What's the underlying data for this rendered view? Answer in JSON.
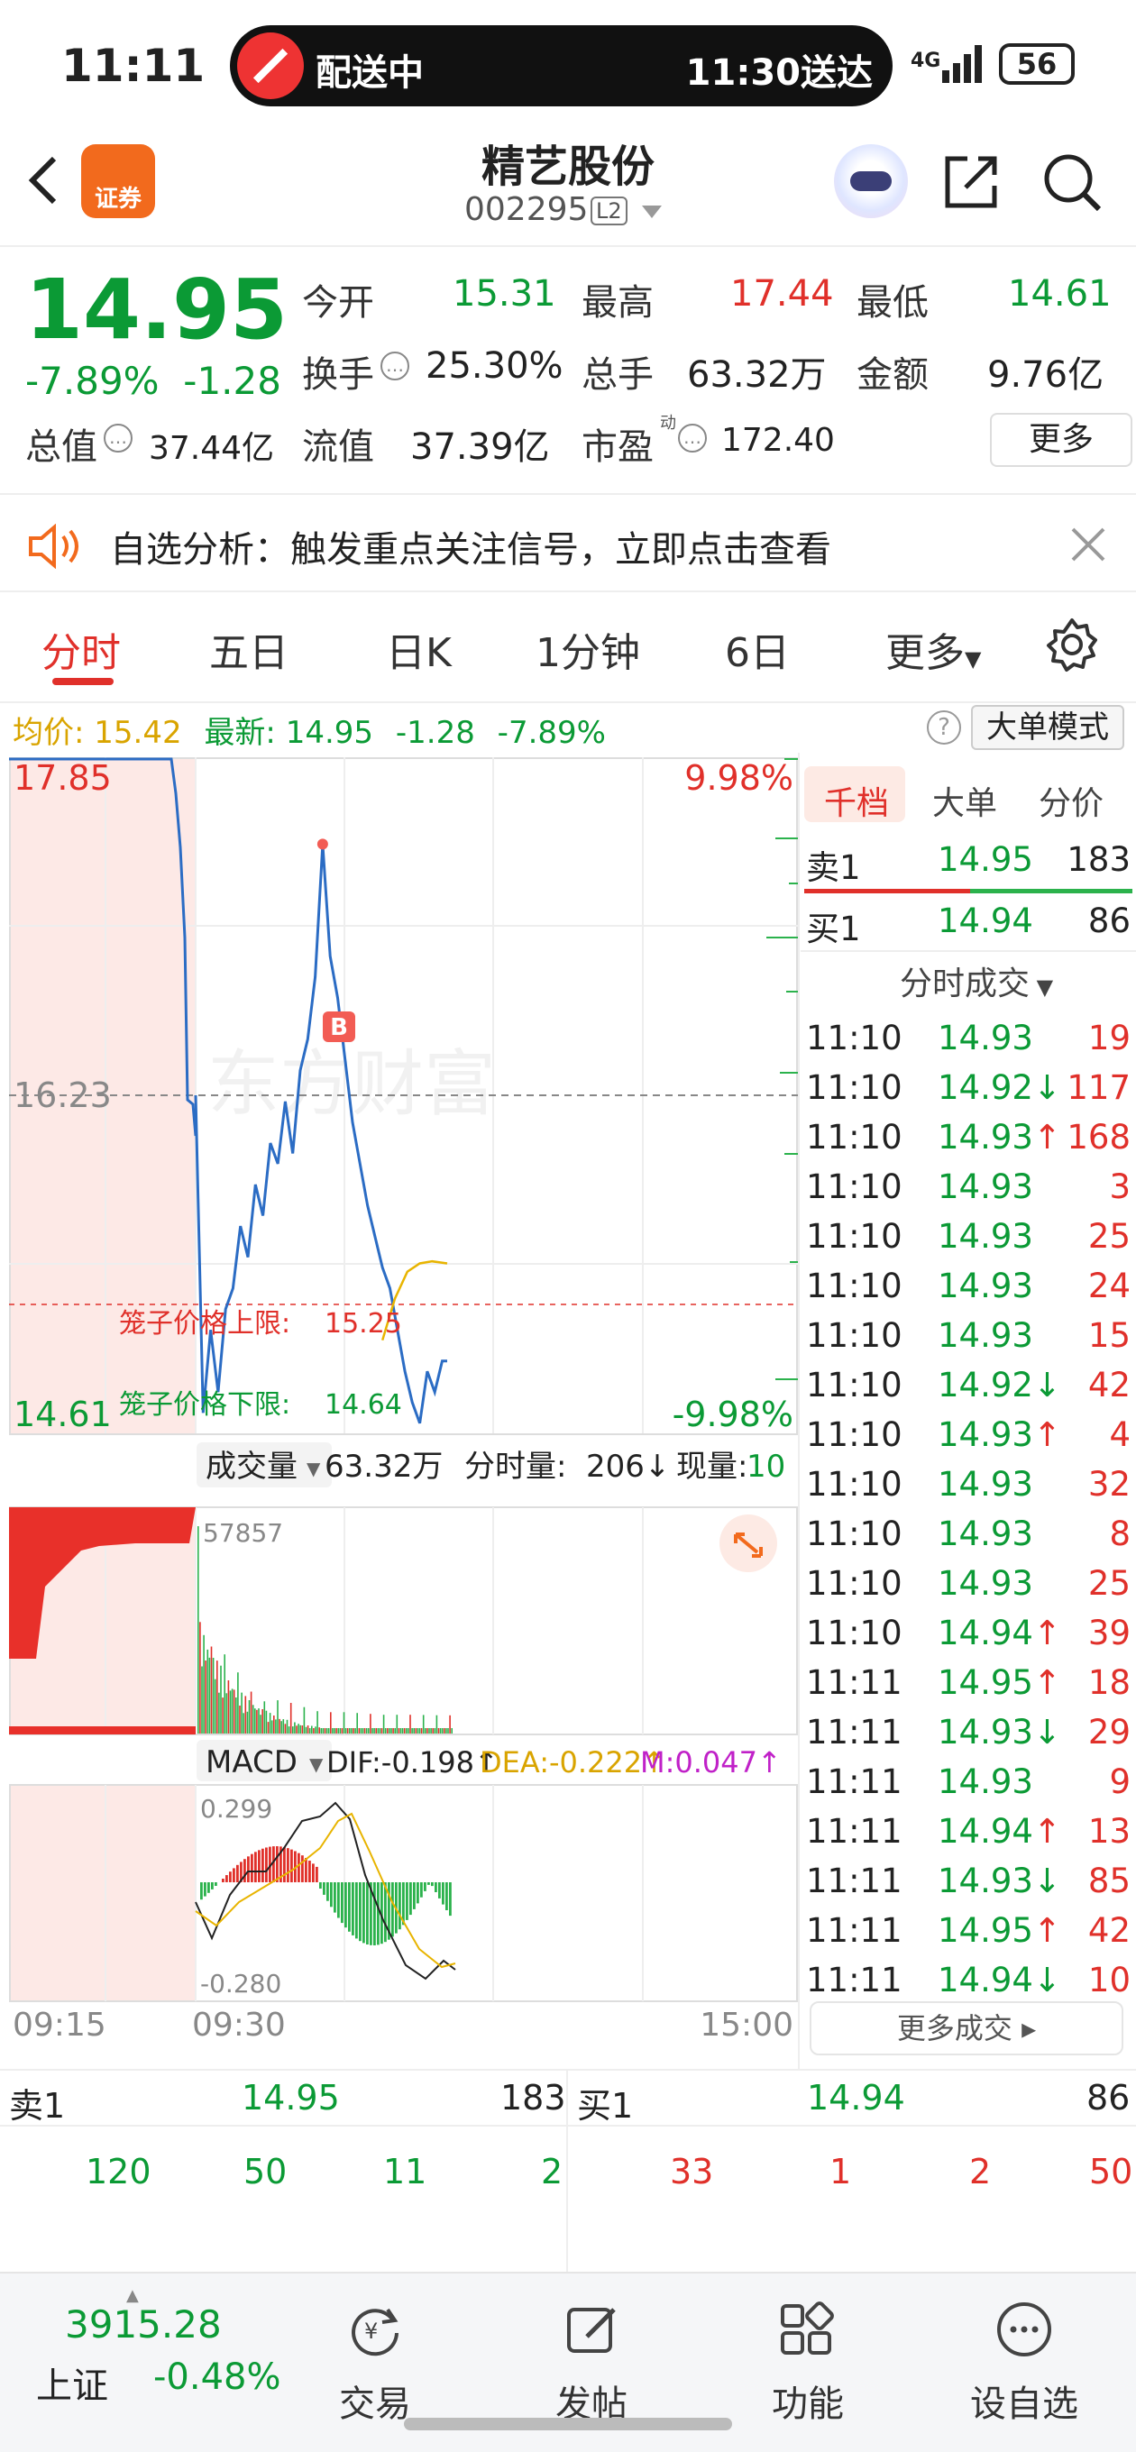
{
  "status_bar": {
    "time": "11:11",
    "pill_left": "配送中",
    "pill_right": "11:30送达",
    "signal": "4G",
    "battery": "56"
  },
  "header": {
    "logo_text": "证券",
    "stock_name": "精艺股份",
    "stock_code": "002295",
    "level_badge": "L2"
  },
  "quote": {
    "price": "14.95",
    "change_pct": "-7.89%",
    "change": "-1.28",
    "open_label": "今开",
    "open": "15.31",
    "high_label": "最高",
    "high": "17.44",
    "low_label": "最低",
    "low": "14.61",
    "turnover_label": "换手",
    "turnover": "25.30%",
    "volume_label": "总手",
    "volume": "63.32万",
    "amount_label": "金额",
    "amount": "9.76亿",
    "mktcap_label": "总值",
    "mktcap": "37.44亿",
    "float_label": "流值",
    "float": "37.39亿",
    "pe_label": "市盈",
    "pe_sup": "动",
    "pe": "172.40",
    "more": "更多"
  },
  "notice": {
    "text": "自选分析：触发重点关注信号，立即点击查看"
  },
  "tabs": [
    "分时",
    "五日",
    "日K",
    "1分钟",
    "6日",
    "更多"
  ],
  "info": {
    "avg_label": "均价:",
    "avg": "15.42",
    "latest_label": "最新:",
    "latest": "14.95",
    "chg": "-1.28",
    "pct": "-7.89%",
    "big_order": "大单模式"
  },
  "chart_data": {
    "type": "line",
    "y_axis_left": [
      "17.85",
      "16.23",
      "14.61"
    ],
    "y_axis_right": [
      "9.98%",
      "-9.98%"
    ],
    "cage_upper_label": "笼子价格上限:",
    "cage_upper": "15.25",
    "cage_lower_label": "笼子价格下限:",
    "cage_lower": "14.64",
    "marker": "B",
    "watermark": "东方财富",
    "time_labels": [
      "09:15",
      "09:30",
      "15:00"
    ],
    "price_series": {
      "name": "price",
      "x": [
        "09:30",
        "09:33",
        "09:36",
        "09:39",
        "09:42",
        "09:45",
        "09:48",
        "09:51",
        "09:54",
        "09:57",
        "10:00",
        "10:03",
        "10:06",
        "10:09",
        "10:12",
        "10:15",
        "10:18",
        "10:21",
        "10:24",
        "10:27",
        "10:30",
        "10:33",
        "10:36",
        "10:39",
        "10:42",
        "10:45",
        "10:48",
        "10:51",
        "10:54",
        "10:57",
        "11:00",
        "11:03",
        "11:06",
        "11:09",
        "11:11"
      ],
      "values": [
        16.23,
        14.7,
        15.1,
        14.8,
        15.2,
        15.3,
        15.6,
        15.45,
        15.8,
        15.65,
        16.0,
        15.9,
        16.2,
        15.95,
        16.35,
        16.5,
        16.8,
        17.44,
        16.9,
        16.7,
        16.4,
        16.1,
        15.9,
        15.7,
        15.55,
        15.4,
        15.3,
        15.1,
        14.9,
        14.75,
        14.65,
        14.9,
        14.8,
        14.95,
        14.95
      ]
    },
    "avg_series": {
      "name": "avg",
      "x": [
        "10:45",
        "10:50",
        "10:55",
        "11:00",
        "11:05",
        "11:11"
      ],
      "values": [
        15.05,
        15.25,
        15.38,
        15.42,
        15.43,
        15.42
      ]
    },
    "volume": {
      "label": "成交量",
      "total": "63.32万",
      "tick_label": "分时量:",
      "tick": "206↓",
      "now_label": "现量:",
      "now": "10",
      "max": "57857"
    },
    "macd": {
      "label": "MACD",
      "dif": "DIF:-0.198↑",
      "dea": "DEA:-0.222↑",
      "m": "M:0.047↑",
      "top": "0.299",
      "bottom": "-0.280"
    }
  },
  "right_panel": {
    "tabs": [
      "千档",
      "大单",
      "分价"
    ],
    "sell1": {
      "label": "卖1",
      "price": "14.95",
      "vol": "183"
    },
    "buy1": {
      "label": "买1",
      "price": "14.94",
      "vol": "86"
    },
    "trades_title": "分时成交",
    "trades": [
      {
        "t": "11:10",
        "p": "14.93",
        "d": "",
        "v": "19"
      },
      {
        "t": "11:10",
        "p": "14.92",
        "d": "↓",
        "v": "117"
      },
      {
        "t": "11:10",
        "p": "14.93",
        "d": "↑",
        "v": "168"
      },
      {
        "t": "11:10",
        "p": "14.93",
        "d": "",
        "v": "3"
      },
      {
        "t": "11:10",
        "p": "14.93",
        "d": "",
        "v": "25"
      },
      {
        "t": "11:10",
        "p": "14.93",
        "d": "",
        "v": "24"
      },
      {
        "t": "11:10",
        "p": "14.93",
        "d": "",
        "v": "15"
      },
      {
        "t": "11:10",
        "p": "14.92",
        "d": "↓",
        "v": "42"
      },
      {
        "t": "11:10",
        "p": "14.93",
        "d": "↑",
        "v": "4"
      },
      {
        "t": "11:10",
        "p": "14.93",
        "d": "",
        "v": "32"
      },
      {
        "t": "11:10",
        "p": "14.93",
        "d": "",
        "v": "8"
      },
      {
        "t": "11:10",
        "p": "14.93",
        "d": "",
        "v": "25"
      },
      {
        "t": "11:10",
        "p": "14.94",
        "d": "↑",
        "v": "39"
      },
      {
        "t": "11:11",
        "p": "14.95",
        "d": "↑",
        "v": "18"
      },
      {
        "t": "11:11",
        "p": "14.93",
        "d": "↓",
        "v": "29"
      },
      {
        "t": "11:11",
        "p": "14.93",
        "d": "",
        "v": "9"
      },
      {
        "t": "11:11",
        "p": "14.94",
        "d": "↑",
        "v": "13"
      },
      {
        "t": "11:11",
        "p": "14.93",
        "d": "↓",
        "v": "85"
      },
      {
        "t": "11:11",
        "p": "14.95",
        "d": "↑",
        "v": "42"
      },
      {
        "t": "11:11",
        "p": "14.94",
        "d": "↓",
        "v": "10"
      }
    ],
    "more_trades": "更多成交"
  },
  "bottom_quote": {
    "sell_label": "卖1",
    "sell_price": "14.95",
    "sell_vol": "183",
    "buy_label": "买1",
    "buy_price": "14.94",
    "buy_vol": "86",
    "sell_orders": [
      "120",
      "50",
      "11",
      "2"
    ],
    "buy_orders": [
      "33",
      "1",
      "2",
      "50"
    ]
  },
  "bottom_nav": {
    "index_value": "3915.28",
    "index_name": "上证",
    "index_pct": "-0.48%",
    "items": [
      "交易",
      "发帖",
      "功能",
      "设自选"
    ]
  }
}
